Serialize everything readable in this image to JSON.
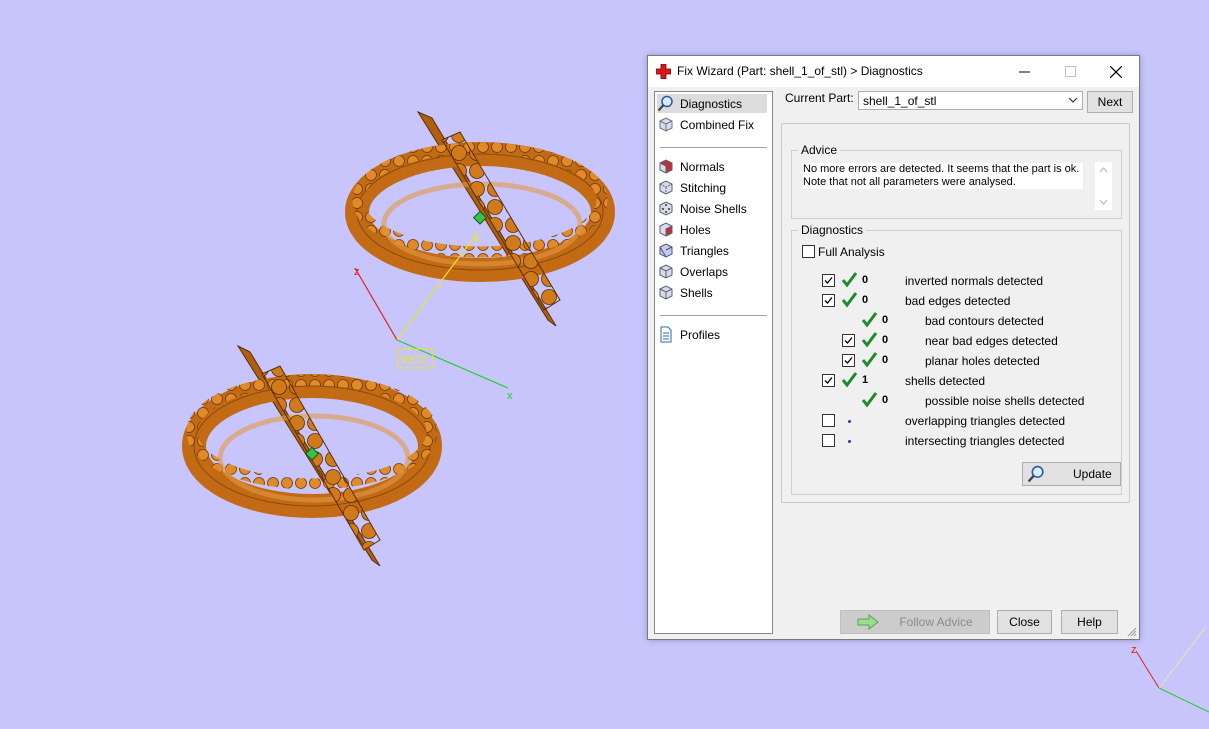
{
  "viewport": {
    "wcs_label": "WCS",
    "axis_x": "x",
    "axis_y": "y",
    "axis_z": "z",
    "corner_axis_z": "z",
    "part_color": "#c86d12",
    "background": "#c8c5fd"
  },
  "dialog": {
    "title": "Fix Wizard (Part: shell_1_of_stl) > Diagnostics",
    "title_icon": "red-cross-icon",
    "current_part_label": "Current Part:",
    "current_part_value": "shell_1_of_stl",
    "next_label": "Next",
    "sidebar": {
      "group1": [
        {
          "label": "Diagnostics",
          "icon": "magnifier-icon",
          "selected": true
        },
        {
          "label": "Combined Fix",
          "icon": "cube-icon"
        }
      ],
      "group2": [
        {
          "label": "Normals",
          "icon": "normals-cube-icon"
        },
        {
          "label": "Stitching",
          "icon": "stitching-cube-icon"
        },
        {
          "label": "Noise Shells",
          "icon": "noise-shells-cube-icon"
        },
        {
          "label": "Holes",
          "icon": "holes-cube-icon"
        },
        {
          "label": "Triangles",
          "icon": "triangles-cube-icon"
        },
        {
          "label": "Overlaps",
          "icon": "overlaps-cube-icon"
        },
        {
          "label": "Shells",
          "icon": "shells-cube-icon"
        }
      ],
      "group3": [
        {
          "label": "Profiles",
          "icon": "document-icon"
        }
      ]
    },
    "advice": {
      "legend": "Advice",
      "line1": "No more errors are detected. It seems that the part is ok.",
      "line2": "Note that not all parameters were analysed."
    },
    "diagnostics": {
      "legend": "Diagnostics",
      "full_analysis_label": "Full Analysis",
      "full_analysis_checked": false,
      "rows": [
        {
          "checked": true,
          "status": "ok",
          "count": "0",
          "label": "inverted normals detected",
          "indent": 0
        },
        {
          "checked": true,
          "status": "ok",
          "count": "0",
          "label": "bad edges detected",
          "indent": 0
        },
        {
          "checkbox": false,
          "status": "ok",
          "count": "0",
          "label": "bad contours detected",
          "indent": 1
        },
        {
          "checked": true,
          "status": "ok",
          "count": "0",
          "label": "near bad edges detected",
          "indent": 1
        },
        {
          "checked": true,
          "status": "ok",
          "count": "0",
          "label": "planar holes detected",
          "indent": 1
        },
        {
          "checked": true,
          "status": "ok",
          "count": "1",
          "label": "shells detected",
          "indent": 0
        },
        {
          "checkbox": false,
          "status": "ok",
          "count": "0",
          "label": "possible noise shells detected",
          "indent": 1
        },
        {
          "checked": false,
          "status": "not-run",
          "count": "",
          "label": "overlapping triangles detected",
          "indent": 0
        },
        {
          "checked": false,
          "status": "not-run",
          "count": "",
          "label": "intersecting triangles detected",
          "indent": 0
        }
      ],
      "update_label": "Update"
    },
    "buttons": {
      "follow_advice": "Follow Advice",
      "close": "Close",
      "help": "Help"
    }
  }
}
